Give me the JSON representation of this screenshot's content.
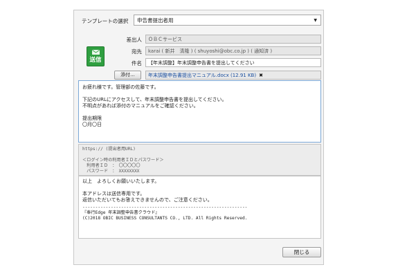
{
  "template": {
    "label": "テンプレートの選択",
    "selected": "申告書提出者用"
  },
  "send_button": {
    "label": "送信"
  },
  "fields": {
    "sender_label": "差出人",
    "sender_value": "ＯＢＣサービス",
    "to_label": "宛先",
    "to_value": "karai ( 新井　清隆 ) ( shuyoshi@obc.co.jp ) ( 通知済 )",
    "subject_label": "件名",
    "subject_value": "【年末調整】年末調整申告書を提出してください"
  },
  "attachment": {
    "button_label": "添付...",
    "file": "年末調整申告書提出マニュアル.docx (12.91 KB)",
    "remove": "✖"
  },
  "body": {
    "lines": [
      "お疲れ様です。管理部の佐藤です。",
      "",
      "下記のURLにアクセスして、年末調整申告書を提出してください。",
      "不明点があれば添付のマニュアルをご確認ください。",
      "",
      "提出期限",
      "〇月〇日"
    ]
  },
  "url_block": {
    "lines": [
      "https:// (提出者用URL)",
      "",
      "＜ログイン時の利用者ＩＤとパスワード＞",
      "　利用者ＩＤ　：　〇〇〇〇〇",
      "　パスワード　：　XXXXXXXX"
    ]
  },
  "footer": {
    "lines": [
      "以上　よろしくお願いいたします。",
      "",
      "本アドレスは送信専用です。",
      "返信いただいてもお答えできませんので、ご注意ください。"
    ],
    "mono_lines": [
      "----------------------------------------------------------------",
      "『奉行Edge 年末調整申告書クラウド』",
      "(C)2018 OBIC BUSINESS CONSULTANTS CO., LTD. All Rights Reserved."
    ]
  },
  "close_button": {
    "label": "閉じる"
  }
}
